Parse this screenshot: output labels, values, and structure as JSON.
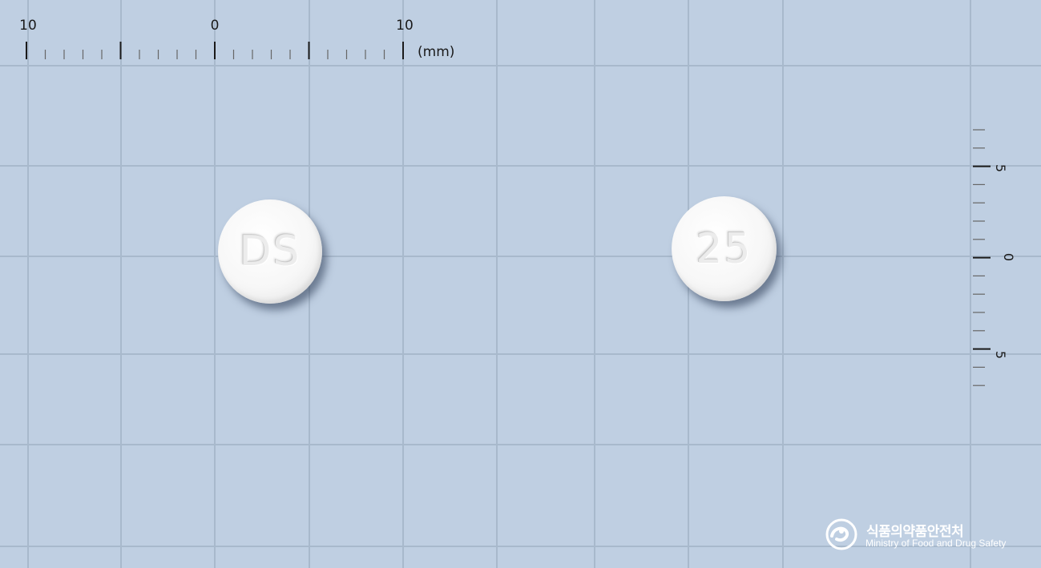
{
  "ruler_top": {
    "labels": [
      "10",
      "0",
      "10"
    ],
    "unit": "(mm)"
  },
  "ruler_right": {
    "labels": [
      "5",
      "0",
      "5"
    ]
  },
  "pills": {
    "front": {
      "imprint": "DS"
    },
    "back": {
      "imprint": "25"
    }
  },
  "logo": {
    "korean": "식품의약품안전처",
    "english": "Ministry of Food and Drug Safety"
  },
  "colors": {
    "background": "#bfcfe2",
    "grid_line": "#a9bacd",
    "ruler_ink": "#1a1a1a",
    "pill": "#f4f4f4"
  }
}
